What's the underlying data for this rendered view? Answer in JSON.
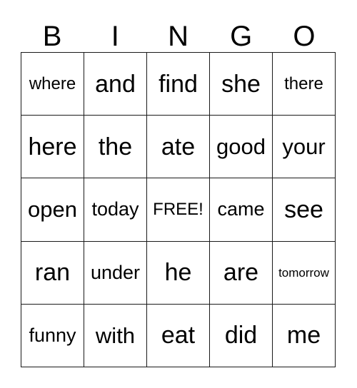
{
  "card": {
    "title_letters": [
      "B",
      "I",
      "N",
      "G",
      "O"
    ],
    "free_space_label": "FREE!",
    "colors": {
      "background": "#ffffff",
      "border": "#1a1a1a",
      "text": "#000000"
    },
    "grid": {
      "columns": 5,
      "rows": 5,
      "cells": [
        [
          {
            "text": "where",
            "size": "sm"
          },
          {
            "text": "and",
            "size": "xl"
          },
          {
            "text": "find",
            "size": "xl"
          },
          {
            "text": "she",
            "size": "xl"
          },
          {
            "text": "there",
            "size": "sm"
          }
        ],
        [
          {
            "text": "here",
            "size": "xl"
          },
          {
            "text": "the",
            "size": "xl"
          },
          {
            "text": "ate",
            "size": "xl"
          },
          {
            "text": "good",
            "size": "lg"
          },
          {
            "text": "your",
            "size": "lg"
          }
        ],
        [
          {
            "text": "open",
            "size": "lg"
          },
          {
            "text": "today",
            "size": "md"
          },
          {
            "text": "FREE!",
            "size": "sm"
          },
          {
            "text": "came",
            "size": "md"
          },
          {
            "text": "see",
            "size": "xl"
          }
        ],
        [
          {
            "text": "ran",
            "size": "xl"
          },
          {
            "text": "under",
            "size": "md"
          },
          {
            "text": "he",
            "size": "xl"
          },
          {
            "text": "are",
            "size": "xl"
          },
          {
            "text": "tomorrow",
            "size": "xs"
          }
        ],
        [
          {
            "text": "funny",
            "size": "md"
          },
          {
            "text": "with",
            "size": "lg"
          },
          {
            "text": "eat",
            "size": "xl"
          },
          {
            "text": "did",
            "size": "xl"
          },
          {
            "text": "me",
            "size": "xl"
          }
        ]
      ]
    }
  }
}
